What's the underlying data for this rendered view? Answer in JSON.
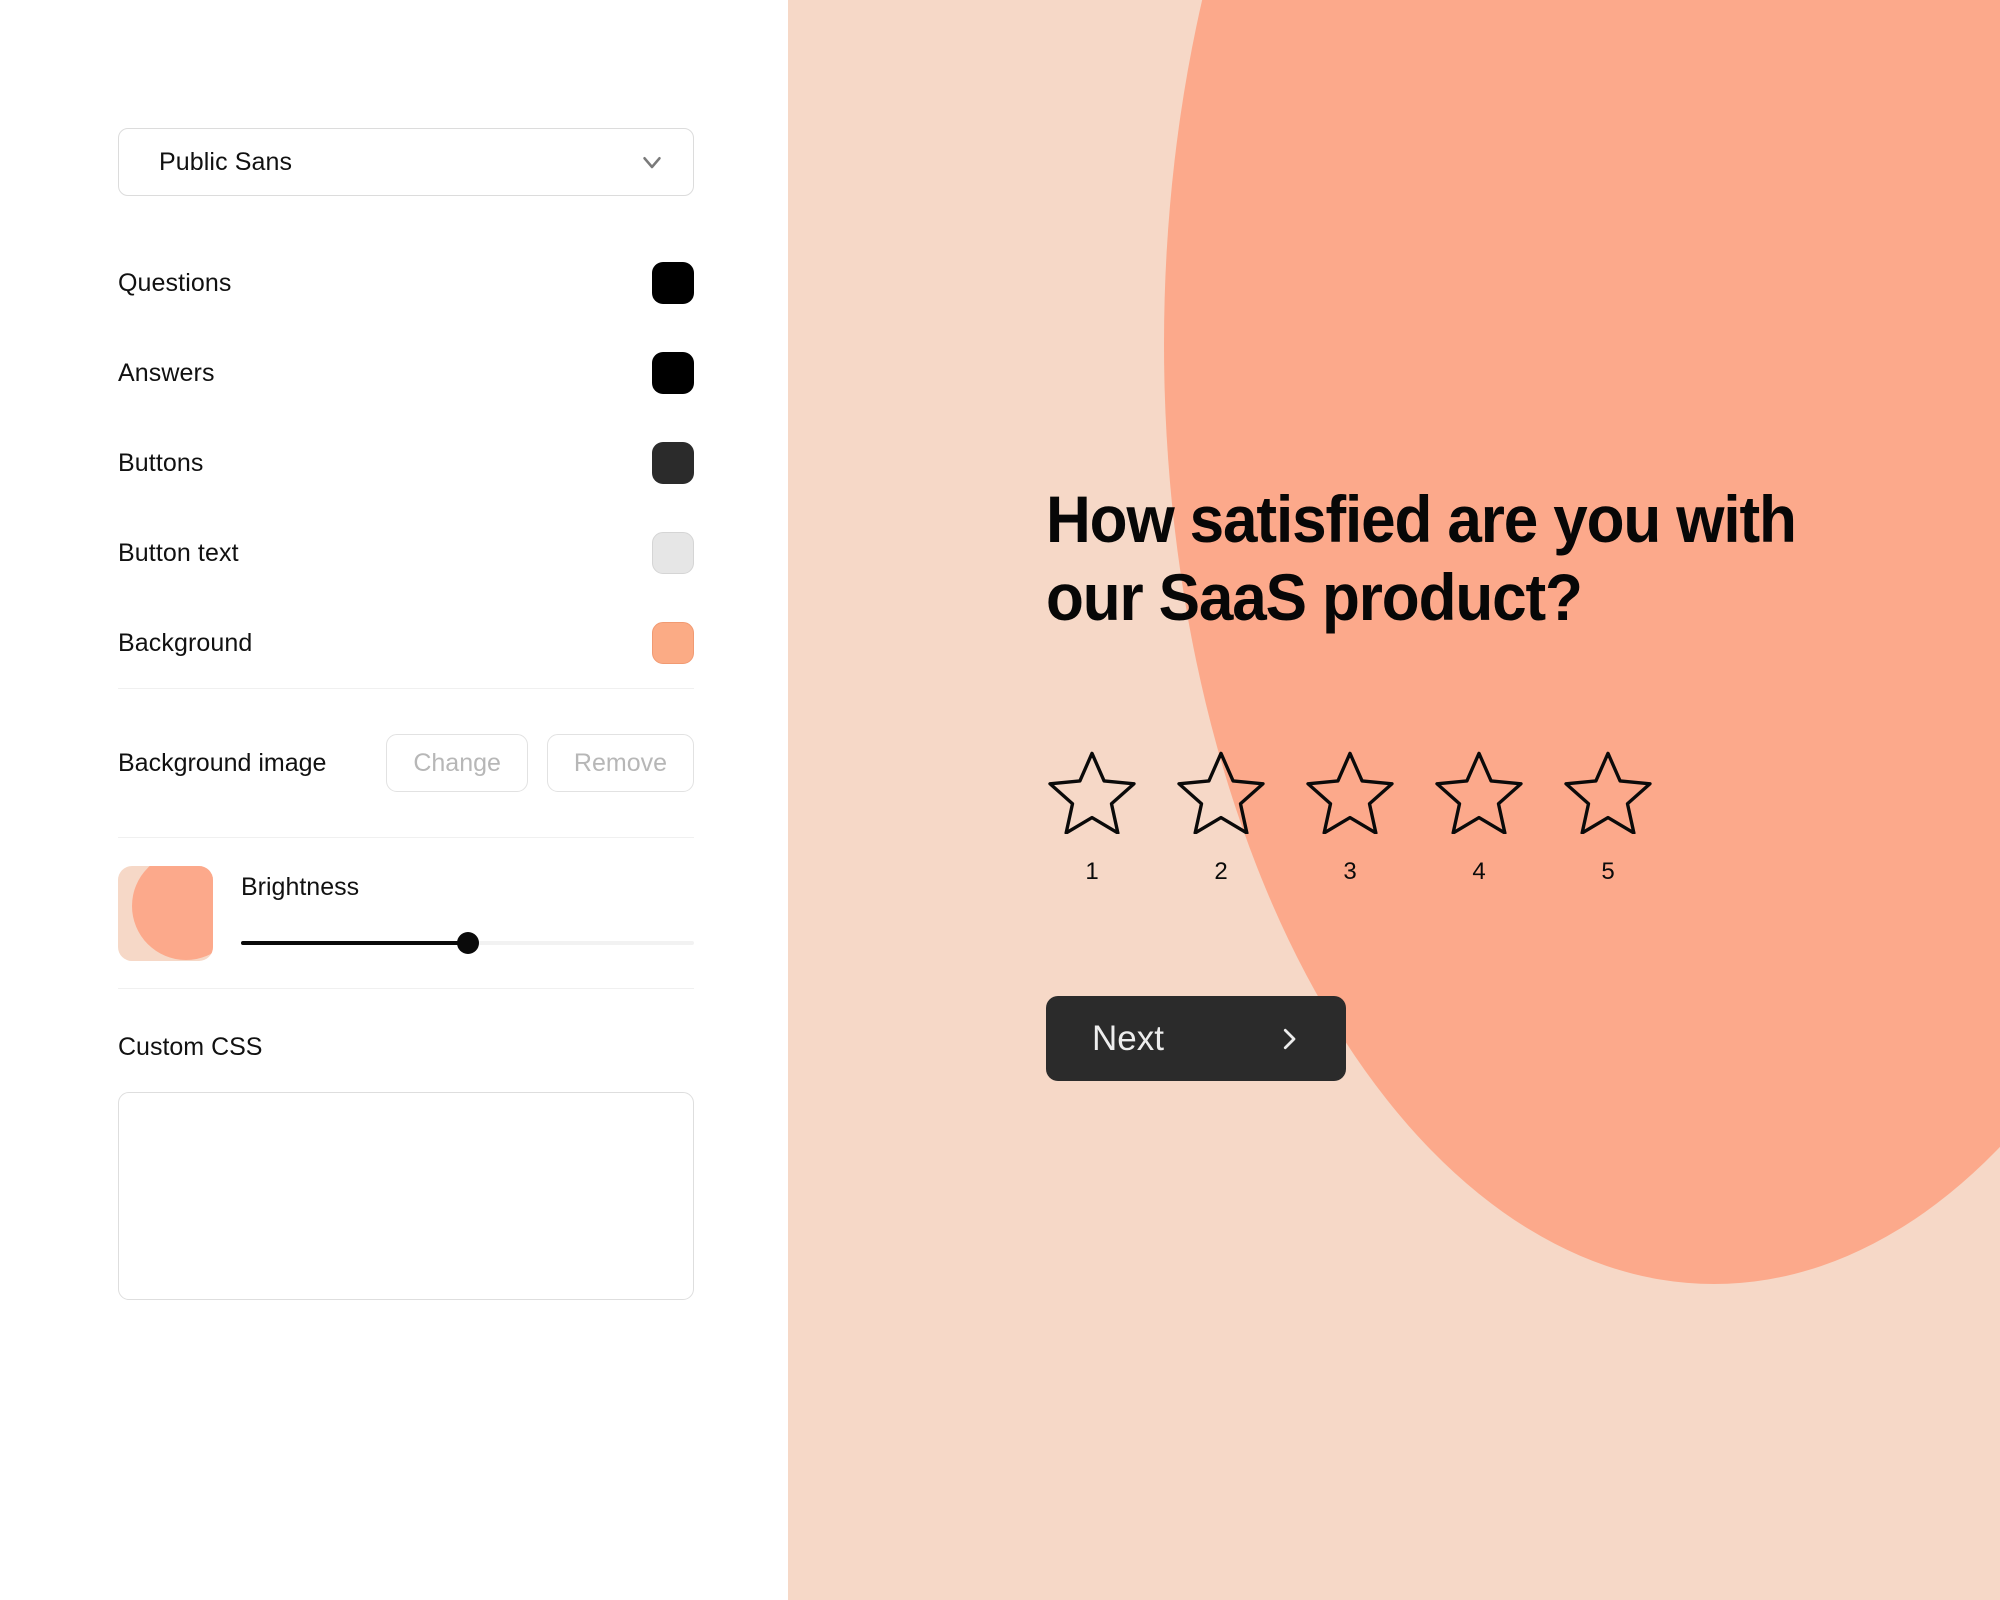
{
  "editor": {
    "font_select": {
      "value": "Public Sans",
      "icon": "chevron-down-icon"
    },
    "color_rows": [
      {
        "label": "Questions",
        "color": "#000000"
      },
      {
        "label": "Answers",
        "color": "#000000"
      },
      {
        "label": "Buttons",
        "color": "#2b2b2b"
      },
      {
        "label": "Button text",
        "color": "#e6e6e6"
      },
      {
        "label": "Background",
        "color": "#fbab85"
      }
    ],
    "background_image": {
      "label": "Background image",
      "change_label": "Change",
      "remove_label": "Remove"
    },
    "brightness": {
      "label": "Brightness",
      "value": 50,
      "preview_base_color": "#f6d8c7",
      "preview_circle_color": "#fca98b"
    },
    "custom_css": {
      "label": "Custom CSS",
      "value": "",
      "placeholder": ""
    }
  },
  "preview": {
    "background_color": "#f6d8c7",
    "accent_shape_color": "#fca98b",
    "question_title": "How satisfied are you with our SaaS product?",
    "rating": {
      "icon": "star-outline-icon",
      "options": [
        "1",
        "2",
        "3",
        "4",
        "5"
      ]
    },
    "next_button": {
      "label": "Next",
      "icon": "chevron-right-icon",
      "background_color": "#2b2b2b",
      "text_color": "#ededed"
    }
  }
}
